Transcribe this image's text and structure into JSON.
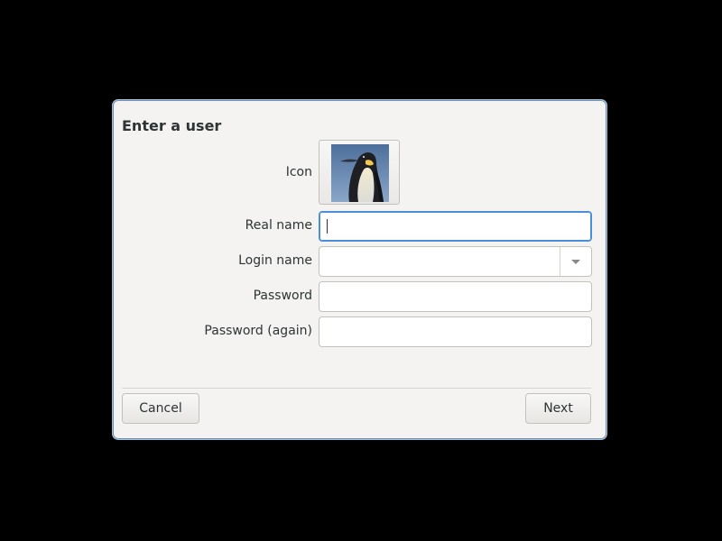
{
  "dialog": {
    "title": "Enter a user",
    "fields": {
      "icon_label": "Icon",
      "icon_image": "penguin-icon",
      "real_name_label": "Real name",
      "real_name_value": "",
      "login_name_label": "Login name",
      "login_name_value": "",
      "password_label": "Password",
      "password_value": "",
      "password_again_label": "Password (again)",
      "password_again_value": ""
    },
    "buttons": {
      "cancel_label": "Cancel",
      "next_label": "Next"
    }
  },
  "colors": {
    "background": "#000000",
    "dialog_bg": "#f4f3f1",
    "focus_accent": "#4a90d9",
    "text": "#2e3436"
  }
}
